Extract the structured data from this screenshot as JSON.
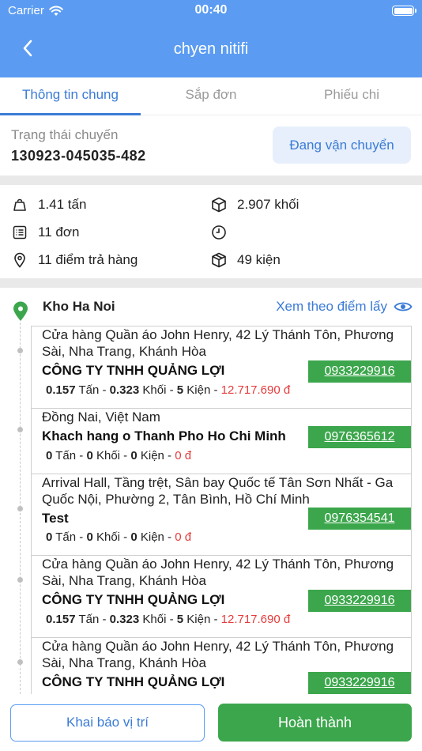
{
  "status_bar": {
    "carrier": "Carrier",
    "time": "00:40"
  },
  "nav": {
    "title": "chyen nitifi"
  },
  "tabs": [
    {
      "label": "Thông tin chung",
      "active": true
    },
    {
      "label": "Sắp đơn",
      "active": false
    },
    {
      "label": "Phiếu chi",
      "active": false
    }
  ],
  "trip": {
    "status_label": "Trạng thái chuyến",
    "code": "130923-045035-482",
    "status": "Đang vận chuyển"
  },
  "stats": {
    "weight": "1.41 tấn",
    "volume": "2.907 khối",
    "orders": "11 đơn",
    "time": "",
    "drop_points": "11 điểm trả hàng",
    "packages": "49 kiện"
  },
  "route": {
    "warehouse": "Kho Ha Noi",
    "view_link": "Xem theo điểm lấy",
    "stops": [
      {
        "address": "Cửa hàng Quần áo John Henry, 42 Lý Thánh Tôn, Phương Sài, Nha Trang, Khánh Hòa",
        "company": "CÔNG TY TNHH QUẢNG LỢI",
        "phone": "0933229916",
        "tons": "0.157",
        "tons_unit": "Tấn",
        "volume": "0.323",
        "volume_unit": "Khối",
        "packages": "5",
        "packages_unit": "Kiện",
        "amount": "12.717.690 đ"
      },
      {
        "address": "Đồng Nai, Việt Nam",
        "company": "Khach hang o Thanh Pho Ho Chi Minh",
        "phone": "0976365612",
        "tons": "0",
        "tons_unit": "Tấn",
        "volume": "0",
        "volume_unit": "Khối",
        "packages": "0",
        "packages_unit": "Kiện",
        "amount": "0 đ"
      },
      {
        "address": "Arrival Hall, Tầng trệt, Sân bay Quốc tế Tân Sơn Nhất - Ga Quốc Nội, Phường 2, Tân Bình, Hồ Chí Minh",
        "company": "Test",
        "phone": "0976354541",
        "tons": "0",
        "tons_unit": "Tấn",
        "volume": "0",
        "volume_unit": "Khối",
        "packages": "0",
        "packages_unit": "Kiện",
        "amount": "0 đ"
      },
      {
        "address": "Cửa hàng Quần áo John Henry, 42 Lý Thánh Tôn, Phương Sài, Nha Trang, Khánh Hòa",
        "company": "CÔNG TY TNHH QUẢNG LỢI",
        "phone": "0933229916",
        "tons": "0.157",
        "tons_unit": "Tấn",
        "volume": "0.323",
        "volume_unit": "Khối",
        "packages": "5",
        "packages_unit": "Kiện",
        "amount": "12.717.690 đ"
      },
      {
        "address": "Cửa hàng Quần áo John Henry, 42 Lý Thánh Tôn, Phương Sài, Nha Trang, Khánh Hòa",
        "company": "CÔNG TY TNHH QUẢNG LỢI",
        "phone": "0933229916",
        "tons": "",
        "tons_unit": "",
        "volume": "",
        "volume_unit": "",
        "packages": "",
        "packages_unit": "",
        "amount": ""
      }
    ]
  },
  "actions": {
    "declare_location": "Khai báo vị trí",
    "complete": "Hoàn thành"
  },
  "colors": {
    "header": "#5b9cf2",
    "accent": "#3b7bd6",
    "green": "#3ca64c",
    "money": "#e53b3b"
  }
}
